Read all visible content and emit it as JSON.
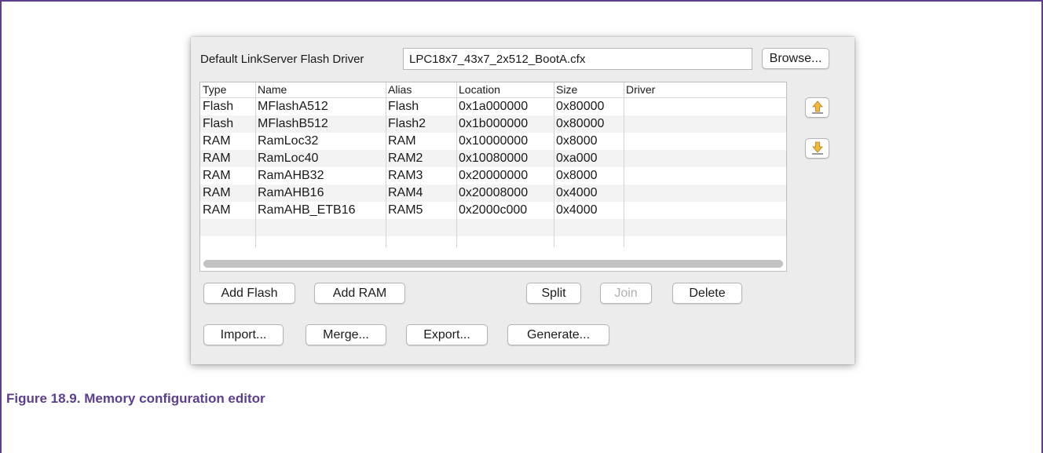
{
  "driver": {
    "label": "Default LinkServer Flash Driver",
    "value": "LPC18x7_43x7_2x512_BootA.cfx",
    "browse_label": "Browse..."
  },
  "table": {
    "headers": [
      "Type",
      "Name",
      "Alias",
      "Location",
      "Size",
      "Driver"
    ],
    "rows": [
      [
        "Flash",
        "MFlashA512",
        "Flash",
        "0x1a000000",
        "0x80000",
        ""
      ],
      [
        "Flash",
        "MFlashB512",
        "Flash2",
        "0x1b000000",
        "0x80000",
        ""
      ],
      [
        "RAM",
        "RamLoc32",
        "RAM",
        "0x10000000",
        "0x8000",
        ""
      ],
      [
        "RAM",
        "RamLoc40",
        "RAM2",
        "0x10080000",
        "0xa000",
        ""
      ],
      [
        "RAM",
        "RamAHB32",
        "RAM3",
        "0x20000000",
        "0x8000",
        ""
      ],
      [
        "RAM",
        "RamAHB16",
        "RAM4",
        "0x20008000",
        "0x4000",
        ""
      ],
      [
        "RAM",
        "RamAHB_ETB16",
        "RAM5",
        "0x2000c000",
        "0x4000",
        ""
      ]
    ]
  },
  "side_buttons": {
    "move_up_icon": "arrow-up-icon",
    "move_down_icon": "arrow-down-icon",
    "arrow_color": "#f4b93a"
  },
  "buttons": {
    "add_flash": "Add Flash",
    "add_ram": "Add RAM",
    "split": "Split",
    "join": "Join",
    "delete": "Delete",
    "import": "Import...",
    "merge": "Merge...",
    "export": "Export...",
    "generate": "Generate..."
  },
  "caption": "Figure 18.9. Memory configuration editor",
  "colors": {
    "accent": "#5c3f8f",
    "panel": "#ececec"
  }
}
